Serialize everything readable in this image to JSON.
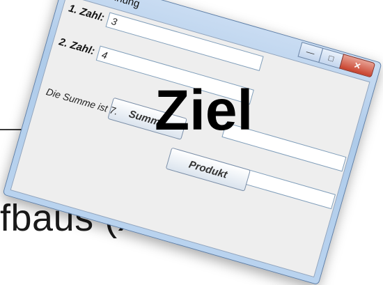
{
  "slide": {
    "background_text": "fbaus (XII)",
    "overlay_title": "Ziel"
  },
  "window": {
    "title": "Berechnung",
    "controls": {
      "minimize": "—",
      "maximize": "□",
      "close": "✕"
    }
  },
  "form": {
    "label1": "1. Zahl:",
    "value1": "3",
    "label2": "2. Zahl:",
    "value2": "4",
    "field3_value": "",
    "field4_value": "",
    "sum_button": "Summe",
    "product_button": "Produkt",
    "result_text": "Die Summe ist 7."
  },
  "colors": {
    "titlebar": "#b9d3ef",
    "close_button": "#c8412c",
    "client_background": "#eeeeee"
  }
}
